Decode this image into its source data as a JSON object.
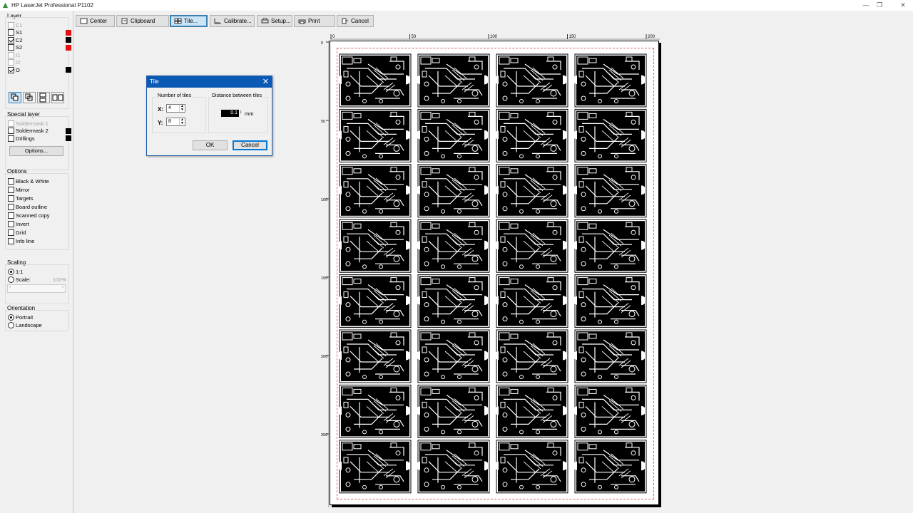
{
  "window": {
    "title": "HP LaserJet Professional P1102"
  },
  "toolbar": {
    "center": "Center",
    "clipboard": "Clipboard",
    "tile": "Tile...",
    "calibrate": "Calibrate...",
    "setup": "Setup...",
    "print": "Print",
    "cancel": "Cancel"
  },
  "layers": {
    "title": "Layer",
    "items": [
      {
        "label": "C1",
        "checked": false,
        "enabled": false,
        "color": ""
      },
      {
        "label": "S1",
        "checked": false,
        "enabled": true,
        "color": "#e01010"
      },
      {
        "label": "C2",
        "checked": true,
        "enabled": true,
        "color": "#000000"
      },
      {
        "label": "S2",
        "checked": false,
        "enabled": true,
        "color": "#e01010"
      },
      {
        "label": "I1",
        "checked": false,
        "enabled": false,
        "color": ""
      },
      {
        "label": "I2",
        "checked": false,
        "enabled": false,
        "color": ""
      },
      {
        "label": "O",
        "checked": true,
        "enabled": true,
        "color": "#000000"
      }
    ]
  },
  "special_layer": {
    "title": "Special layer",
    "items": [
      {
        "label": "Soldermask 1",
        "checked": false,
        "enabled": false,
        "color": ""
      },
      {
        "label": "Soldermask 2",
        "checked": false,
        "enabled": true,
        "color": "#000000"
      },
      {
        "label": "Drillings",
        "checked": false,
        "enabled": true,
        "color": "#000000"
      }
    ],
    "options_button": "Options..."
  },
  "options": {
    "title": "Options",
    "items": [
      "Black & White",
      "Mirror",
      "Targets",
      "Board outline",
      "Scanned copy",
      "Invert",
      "Grid",
      "Info line"
    ]
  },
  "scaling": {
    "title": "Scaling",
    "one_to_one": "1:1",
    "scale": "Scale:",
    "scale_value": "100%"
  },
  "orientation": {
    "title": "Orientation",
    "portrait": "Portrait",
    "landscape": "Landscape"
  },
  "ruler": {
    "top": [
      "0",
      "50",
      "100",
      "150",
      "200"
    ],
    "left": [
      "0",
      "50",
      "100",
      "150",
      "200",
      "250"
    ]
  },
  "tiles": {
    "columns": 4,
    "rows": 8
  },
  "dialog": {
    "title": "Tile",
    "number_of_tiles": "Number of tiles",
    "x_label": "X:",
    "x_value": "4",
    "y_label": "Y:",
    "y_value": "8",
    "distance_label": "Distance between tiles",
    "distance_value": "0.1",
    "unit": "mm",
    "ok": "OK",
    "cancel": "Cancel"
  },
  "colors": {
    "accent": "#0a5ab5",
    "red": "#e01010"
  }
}
